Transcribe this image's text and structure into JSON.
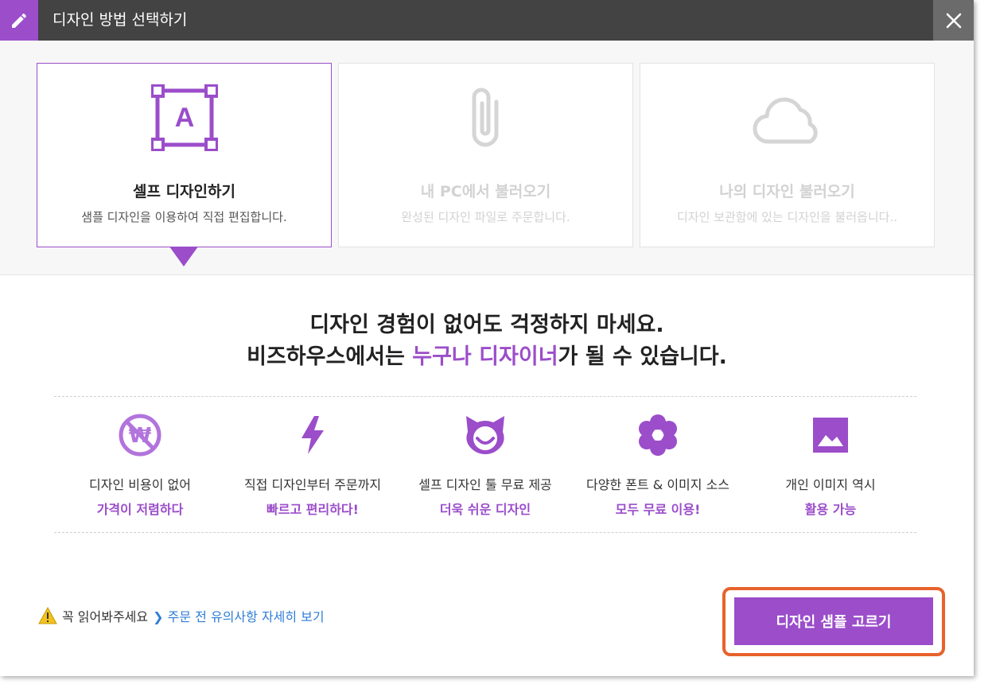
{
  "modal": {
    "title": "디자인 방법 선택하기",
    "title_icon": "pencil-icon",
    "close_icon": "close-icon"
  },
  "options": [
    {
      "title": "셀프 디자인하기",
      "desc": "샘플 디자인을 이용하여 직접 편집합니다.",
      "icon": "text-frame-icon",
      "selected": true
    },
    {
      "title": "내 PC에서 불러오기",
      "desc": "완성된 디자인 파일로 주문합니다.",
      "icon": "paperclip-icon",
      "selected": false
    },
    {
      "title": "나의 디자인 불러오기",
      "desc": "디자인 보관함에 있는 디자인을 불러옵니다..",
      "icon": "cloud-icon",
      "selected": false
    }
  ],
  "headline": {
    "line1": "디자인 경험이 없어도 걱정하지 마세요.",
    "line2_pre": "비즈하우스에서는 ",
    "line2_highlight": "누구나 디자이너",
    "line2_post": "가 될 수 있습니다."
  },
  "features": [
    {
      "line1": "디자인 비용이 없어",
      "line2": "가격이 저렴하다",
      "icon": "no-won-icon"
    },
    {
      "line1": "직접 디자인부터 주문까지",
      "line2": "빠르고 편리하다!",
      "icon": "lightning-icon"
    },
    {
      "line1": "셀프 디자인 툴 무료 제공",
      "line2": "더욱 쉬운 디자인",
      "icon": "cat-face-icon"
    },
    {
      "line1": "다양한 폰트 & 이미지 소스",
      "line2": "모두 무료 이용!",
      "icon": "flower-icon"
    },
    {
      "line1": "개인 이미지 역시",
      "line2": "활용 가능",
      "icon": "image-icon"
    }
  ],
  "notice": {
    "label": "꼭 읽어봐주세요",
    "link": "주문 전 유의사항 자세히 보기",
    "icon": "warning-icon"
  },
  "cta": {
    "label": "디자인 샘플 고르기"
  },
  "colors": {
    "accent": "#9b4dca",
    "titlebar": "#434343",
    "link": "#2f7dd6",
    "highlight_outline": "#e8622c"
  }
}
